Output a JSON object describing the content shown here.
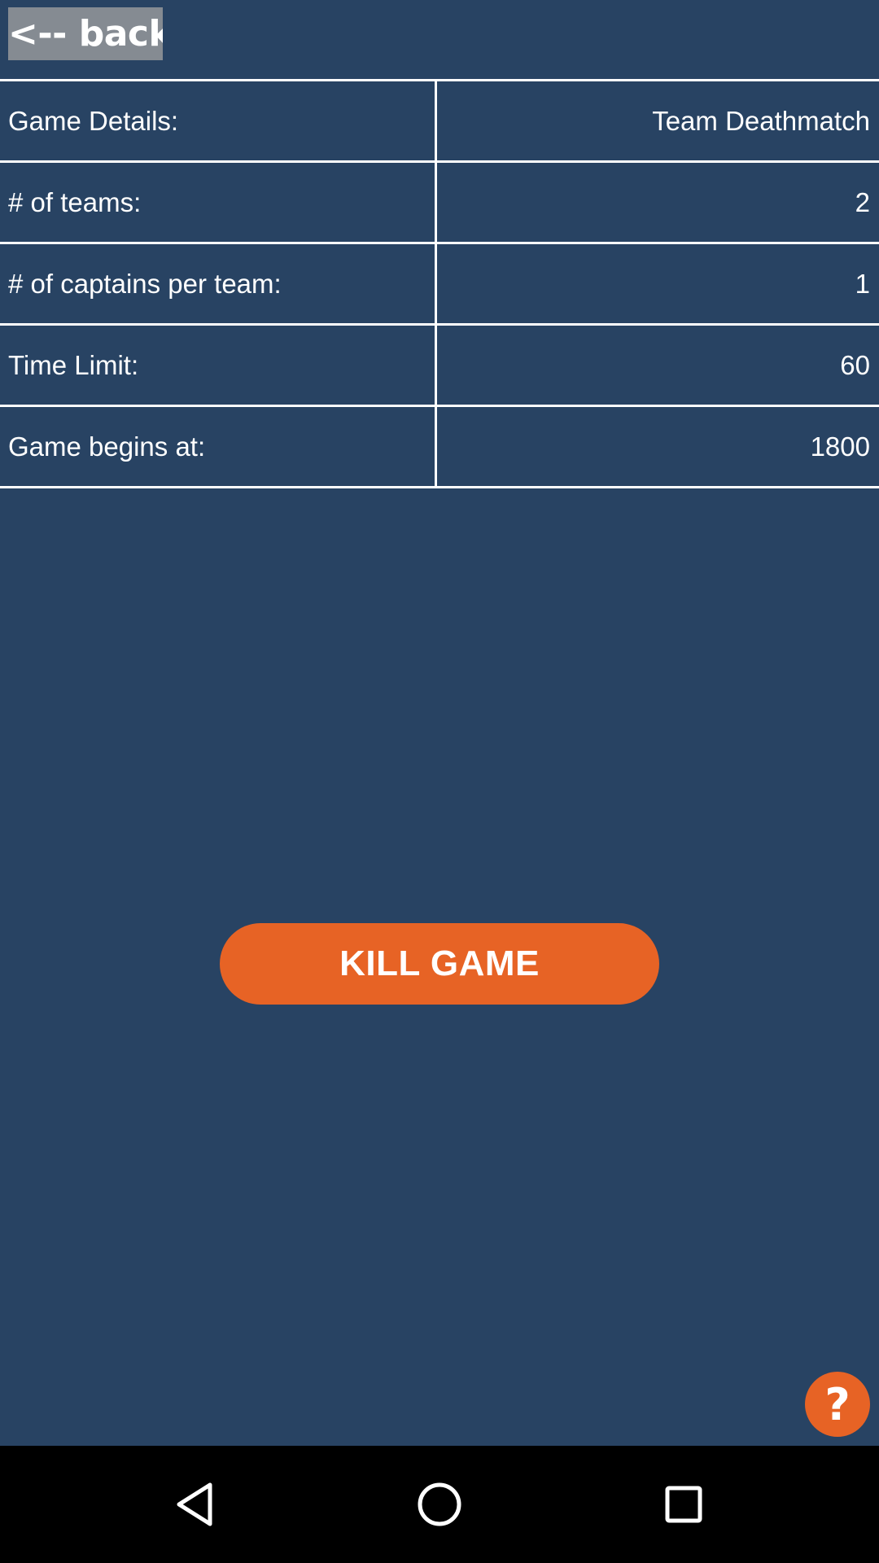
{
  "header": {
    "back_label": "<-- back"
  },
  "game_details": {
    "rows": [
      {
        "label": "Game Details:",
        "value": "Team Deathmatch"
      },
      {
        "label": "# of teams:",
        "value": "2"
      },
      {
        "label": "# of captains per team:",
        "value": "1"
      },
      {
        "label": "Time Limit:",
        "value": "60"
      },
      {
        "label": "Game begins at:",
        "value": "1800"
      }
    ]
  },
  "actions": {
    "kill_label": "KILL GAME",
    "help_label": "?"
  },
  "navbar": {
    "icons": [
      "back-triangle-icon",
      "home-circle-icon",
      "recents-square-icon"
    ]
  },
  "colors": {
    "background": "#284363",
    "accent": "#e76325",
    "back_button": "#858b92",
    "divider": "#ffffff"
  }
}
